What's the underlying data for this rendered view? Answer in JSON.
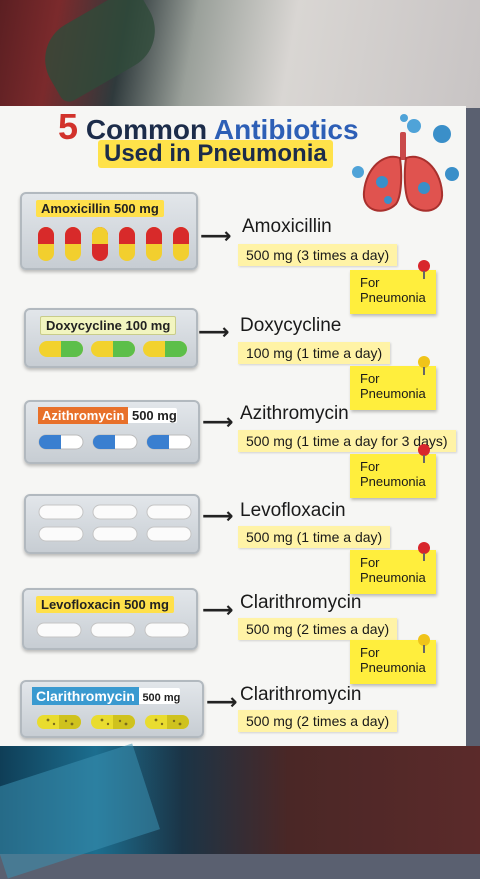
{
  "title": {
    "number": "5",
    "word1": "Common",
    "word2": "Antibiotics",
    "line2": "Used in Pneumonia"
  },
  "colors": {
    "title_red": "#d2322b",
    "title_blue": "#2d5fb6",
    "highlight_yellow": "#ffe24a",
    "sticky_yellow": "#ffee3d",
    "dose_yellow": "#fff3a6",
    "pin_red": "#d8262c",
    "pin_yellow": "#f0c419"
  },
  "entries": [
    {
      "pack_label": "Amoxicillin 500 mg",
      "name": "Amoxicillin",
      "dose": "500 mg (3 times a day)",
      "note_line1": "For",
      "note_line2": "Pneumonia",
      "pill": "red-yellow-capsule"
    },
    {
      "pack_label": "Doxycycline 100 mg",
      "name": "Doxycycline",
      "dose": "100 mg (1 time a day)",
      "note_line1": "For",
      "note_line2": "Pneumonia",
      "pill": "yellow-green-capsule"
    },
    {
      "pack_label_name": "Azithromycin",
      "pack_label_dose": "500 mg",
      "name": "Azithromycin",
      "dose": "500 mg (1 time a day for 3 days)",
      "note_line1": "For",
      "note_line2": "Pneumonia",
      "pill": "blue-white-capsule"
    },
    {
      "name": "Levofloxacin",
      "dose": "500 mg (1 time a day)",
      "note_line1": "For",
      "note_line2": "Pneumonia",
      "pill": "white-oval-tablet"
    },
    {
      "pack_label": "Levofloxacin 500 mg",
      "name": "Clarithromycin",
      "dose": "500 mg (2 times a day)",
      "note_line1": "For",
      "note_line2": "Pneumonia",
      "pill": "white-oval-tablet"
    },
    {
      "pack_label_name": "Clarithromycin",
      "pack_label_dose": "500 mg",
      "name": "Clarithromycin",
      "dose": "500 mg (2 times a day)",
      "pill": "yellow-speckled-capsule"
    }
  ],
  "icons": {
    "lungs": "lungs-with-virus-icon",
    "arrow": "arrow-right-icon",
    "pin": "push-pin-icon"
  }
}
